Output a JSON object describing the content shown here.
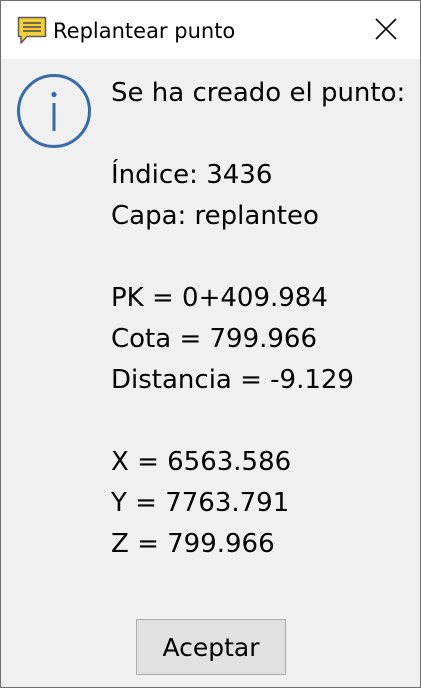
{
  "window": {
    "title": "Replantear punto"
  },
  "icons": {
    "app": "message-balloon-icon",
    "close": "close-icon",
    "info": "information-icon"
  },
  "message": {
    "header": "Se ha creado el punto:",
    "indice": "Índice: 3436",
    "capa": "Capa: replanteo",
    "pk": "PK = 0+409.984",
    "cota": "Cota = 799.966",
    "distancia": "Distancia = -9.129",
    "x": "X = 6563.586",
    "y": "Y = 7763.791",
    "z": "Z = 799.966"
  },
  "buttons": {
    "ok_label": "Aceptar"
  },
  "colors": {
    "info_icon": "#3a6aa8",
    "app_icon": "#e8c230",
    "dialog_background": "#f0f0f0",
    "titlebar_background": "#ffffff"
  }
}
